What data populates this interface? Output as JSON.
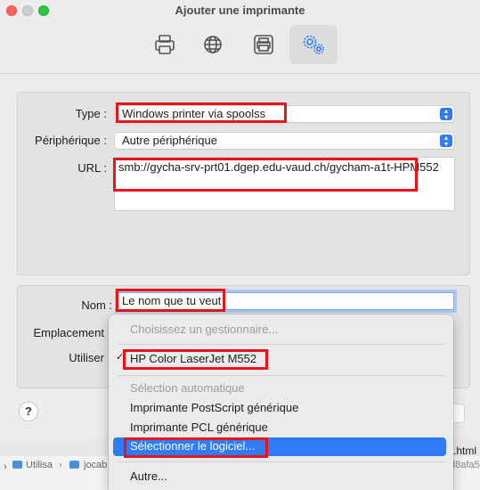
{
  "window": {
    "title": "Ajouter une imprimante"
  },
  "toolbar": {
    "buttons": [
      {
        "name": "default-printer",
        "icon": "printer-icon"
      },
      {
        "name": "ip-printer",
        "icon": "globe-icon"
      },
      {
        "name": "windows-printer",
        "icon": "printer-box-icon"
      },
      {
        "name": "advanced",
        "icon": "gears-icon",
        "selected": true
      }
    ]
  },
  "form": {
    "type_label": "Type :",
    "type_value": "Windows printer via spoolss",
    "device_label": "Périphérique :",
    "device_value": "Autre périphérique",
    "url_label": "URL :",
    "url_value": "smb://gycha-srv-prt01.dgep.edu-vaud.ch/gycham-a1t-HPM552",
    "name_label": "Nom :",
    "name_value": "Le nom que tu veut",
    "location_label": "Emplacement",
    "use_label": "Utiliser",
    "add_button_partial": ""
  },
  "menu": {
    "header": "Choisissez un gestionnaire...",
    "items": [
      {
        "label": "HP Color LaserJet M552",
        "checked": true
      },
      {
        "label": "Sélection automatique",
        "disabled": true
      },
      {
        "label": "Imprimante PostScript générique"
      },
      {
        "label": "Imprimante PCL générique"
      },
      {
        "label": "Sélectionner le logiciel...",
        "highlighted": true
      },
      {
        "label": "Autre..."
      }
    ]
  },
  "background_finder": {
    "path_items": [
      "Utilisa",
      "jocab"
    ],
    "file_suffix": ".html",
    "hash_suffix": "d8afa5"
  },
  "colors": {
    "accent": "#2f7cf6",
    "annotation_red": "#e8141b",
    "highlight": "#2f7cf6"
  }
}
